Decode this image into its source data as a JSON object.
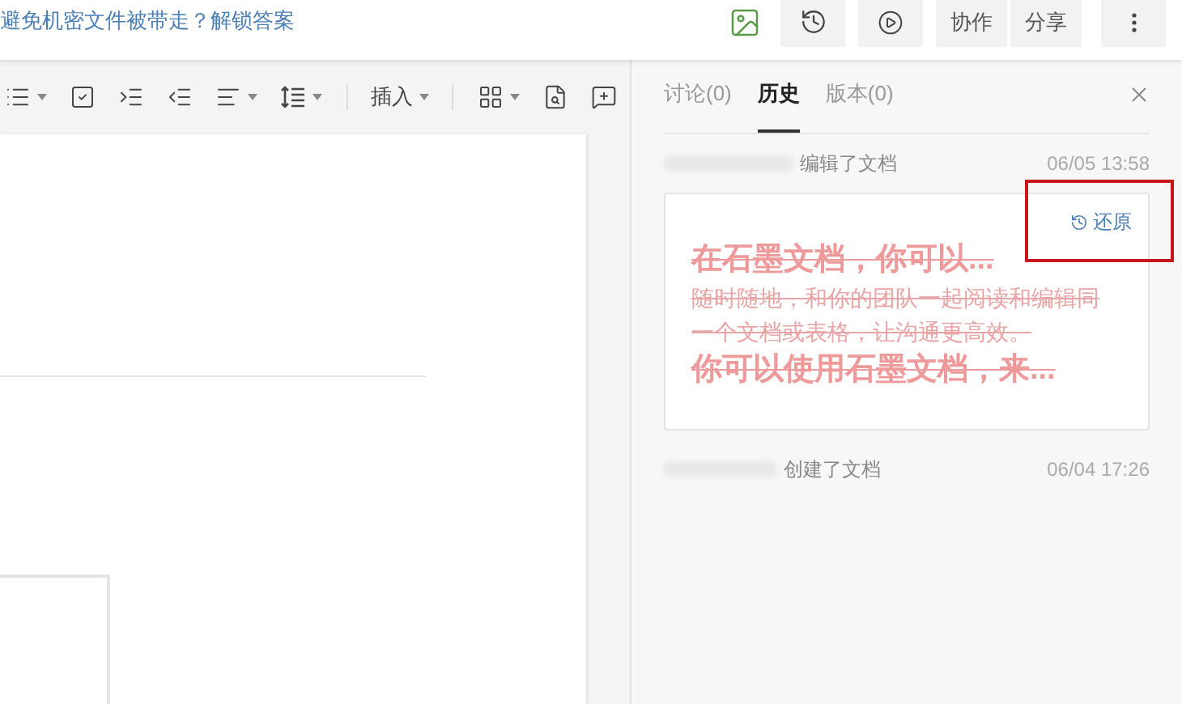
{
  "top_bar": {
    "notice_link": "避免机密文件被带走？解锁答案",
    "buttons": [
      {
        "kind": "image"
      },
      {
        "kind": "history"
      },
      {
        "kind": "play"
      },
      {
        "kind": "text",
        "label": "协作"
      },
      {
        "kind": "text",
        "label": "分享"
      },
      {
        "kind": "more"
      }
    ]
  },
  "toolbar": {
    "items": [
      {
        "kind": "list",
        "caret": true
      },
      {
        "kind": "checklist",
        "caret": false
      },
      {
        "kind": "indent",
        "caret": false
      },
      {
        "kind": "outdent",
        "caret": false
      },
      {
        "kind": "align",
        "caret": true
      },
      {
        "kind": "line-height",
        "caret": true
      },
      {
        "kind": "divider"
      },
      {
        "kind": "text",
        "label": "插入",
        "caret": true
      },
      {
        "kind": "divider"
      },
      {
        "kind": "grid",
        "caret": true
      },
      {
        "kind": "find",
        "caret": false
      },
      {
        "kind": "comment",
        "caret": false
      }
    ]
  },
  "side_panel": {
    "tabs": [
      {
        "label": "讨论(0)",
        "selected": false
      },
      {
        "label": "历史",
        "selected": true
      },
      {
        "label": "版本(0)",
        "selected": false
      }
    ],
    "history": [
      {
        "action": "编辑了文档",
        "time": "06/05 13:58",
        "preview": {
          "restore_label": "还原",
          "highlighted": true,
          "lines": [
            {
              "kind": "heading",
              "text": "在石墨文档，你可以...",
              "deleted": true
            },
            {
              "kind": "paragraph",
              "text": "随时随地，和你的团队一起阅读和编辑同一个文档或表格，让沟通更高效。",
              "deleted": true
            },
            {
              "kind": "heading",
              "text": "你可以使用石墨文档，来...",
              "deleted": true
            }
          ]
        }
      },
      {
        "action": "创建了文档",
        "time": "06/04 17:26"
      }
    ]
  }
}
